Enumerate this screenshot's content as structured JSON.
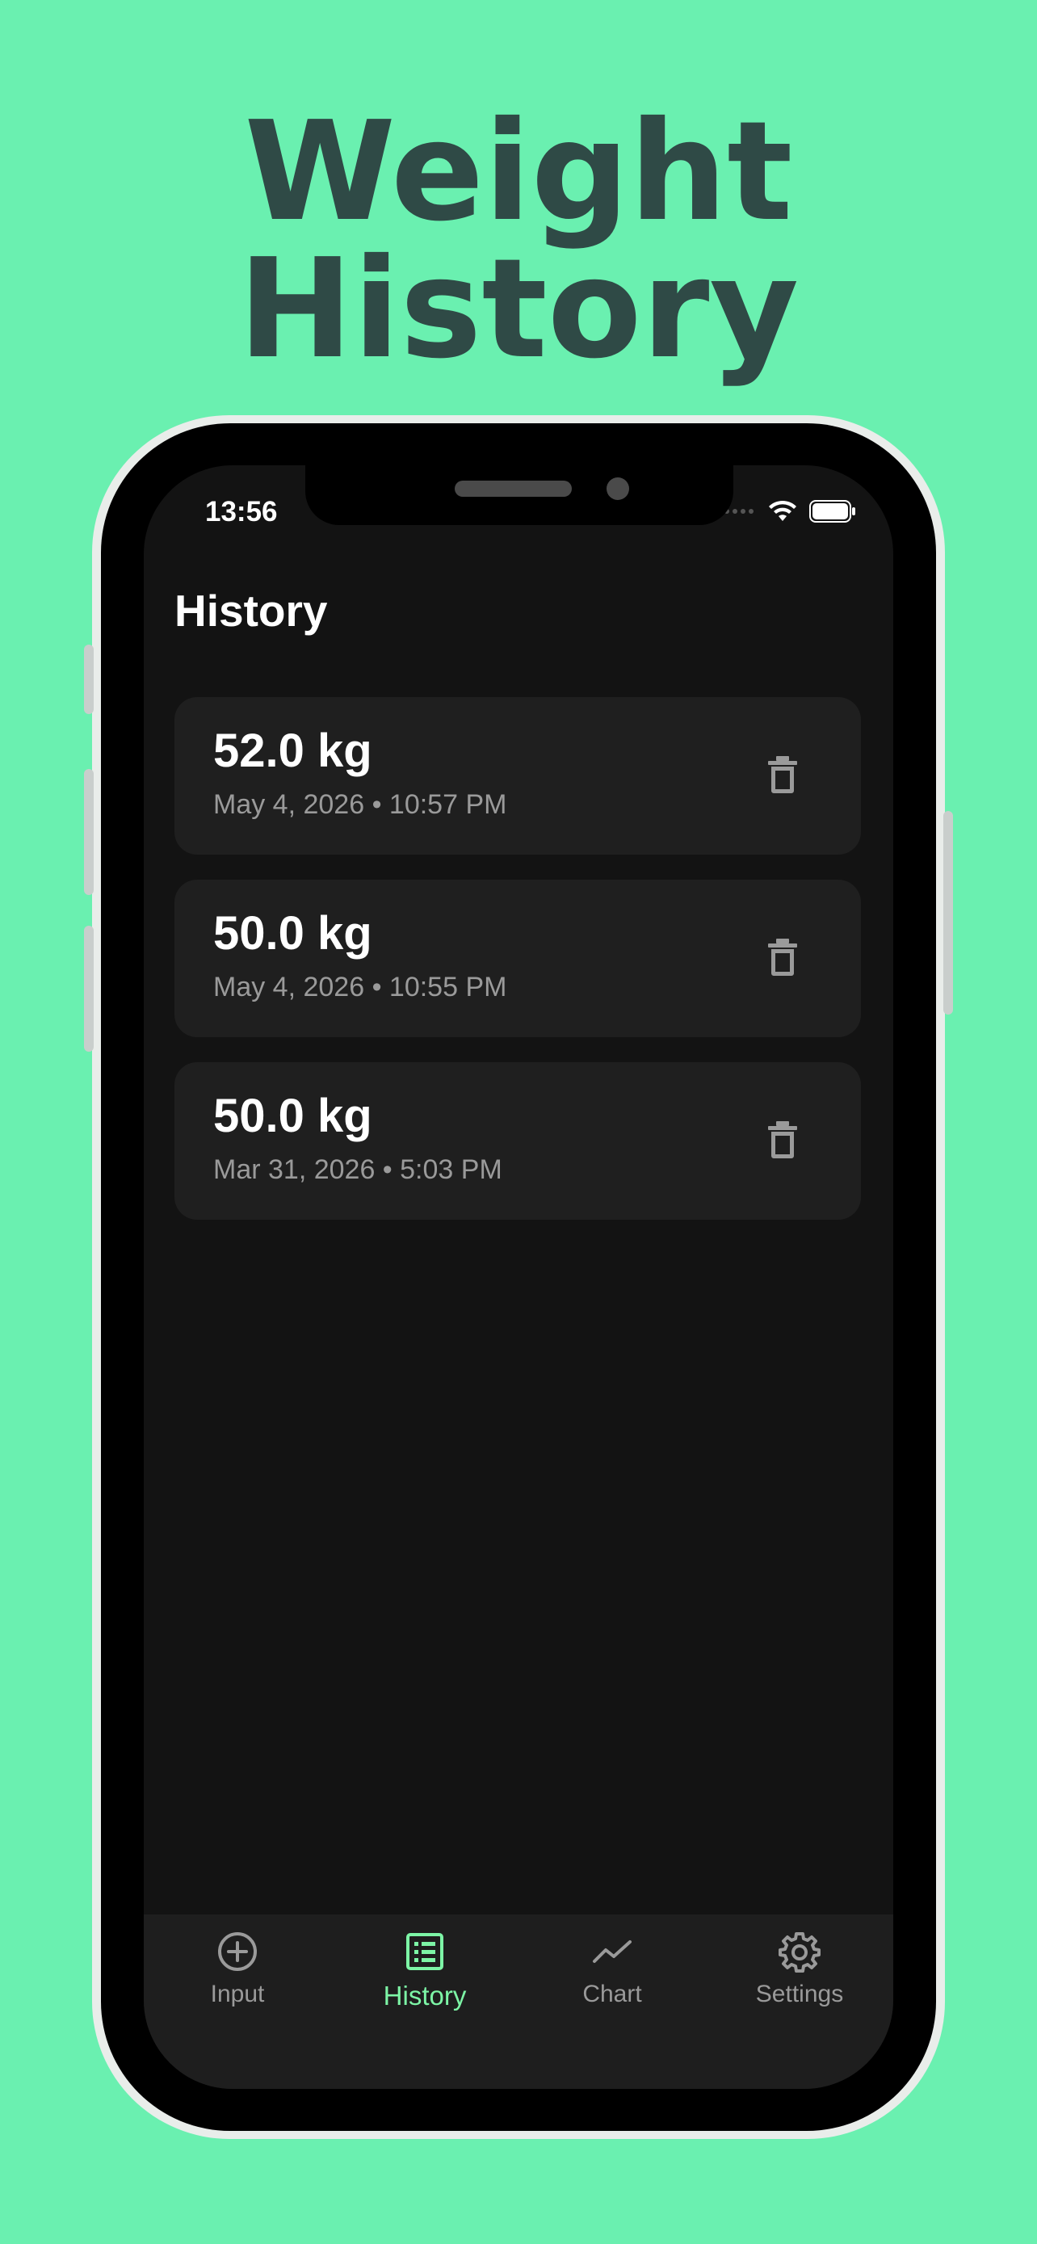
{
  "hero": {
    "title": "Weight History"
  },
  "status": {
    "time": "13:56"
  },
  "screen": {
    "title": "History"
  },
  "entries": [
    {
      "weight": "52.0 kg",
      "datetime": "May 4, 2026 • 10:57 PM"
    },
    {
      "weight": "50.0 kg",
      "datetime": "May 4, 2026 • 10:55 PM"
    },
    {
      "weight": "50.0 kg",
      "datetime": "Mar 31, 2026 • 5:03 PM"
    }
  ],
  "nav": {
    "items": [
      {
        "label": "Input",
        "icon": "plus-circle-icon"
      },
      {
        "label": "History",
        "icon": "list-icon"
      },
      {
        "label": "Chart",
        "icon": "chart-line-icon"
      },
      {
        "label": "Settings",
        "icon": "gear-icon"
      }
    ],
    "active": "History"
  },
  "colors": {
    "background": "#6AF0B0",
    "hero_text": "#2F4A46",
    "screen_bg": "#131313",
    "card_bg": "#1F1F1F",
    "accent": "#7DF5A6",
    "muted": "#9A9A9A"
  }
}
